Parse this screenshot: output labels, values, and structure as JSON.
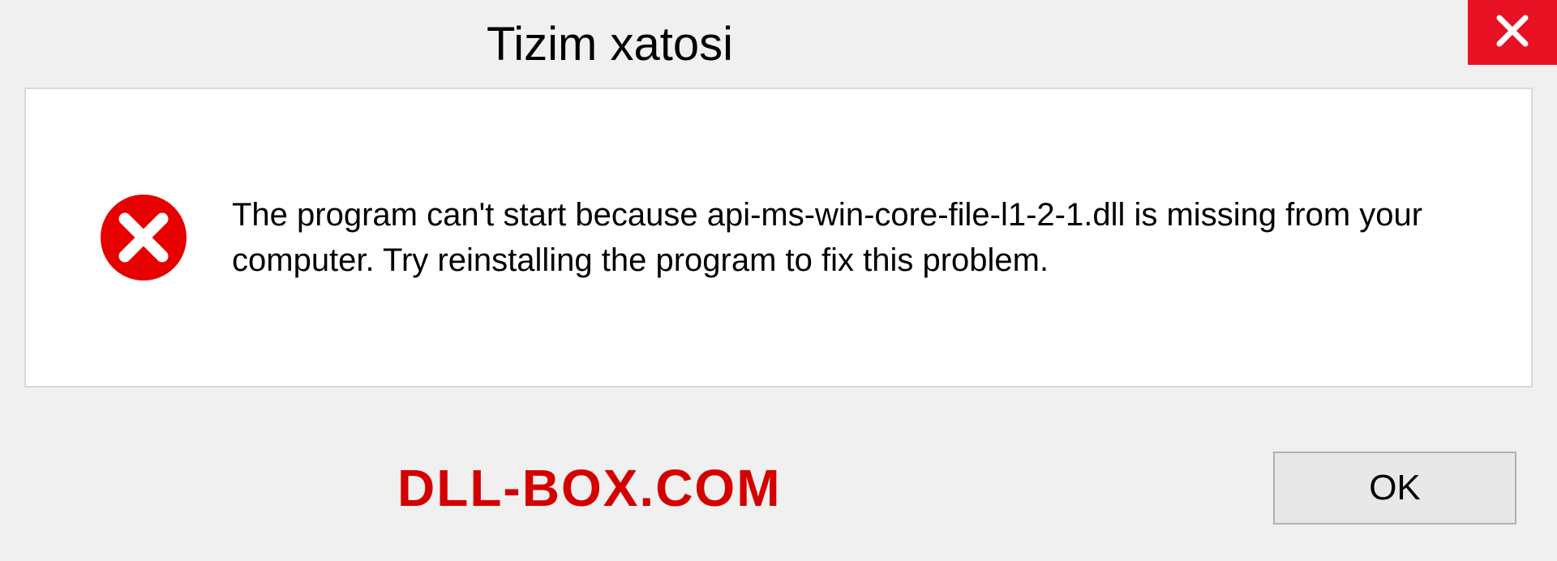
{
  "dialog": {
    "title": "Tizim xatosi",
    "message": "The program can't start because api-ms-win-core-file-l1-2-1.dll is missing from your computer. Try reinstalling the program to fix this problem.",
    "ok_label": "OK"
  },
  "watermark": "DLL-BOX.COM"
}
